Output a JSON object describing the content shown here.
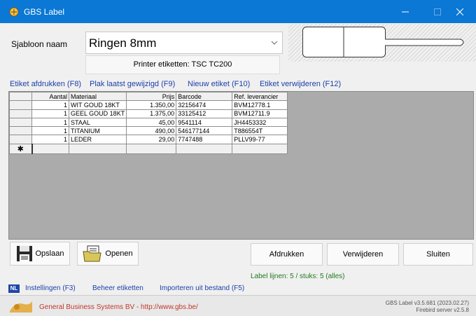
{
  "window": {
    "title": "GBS Label"
  },
  "form": {
    "template_label": "Sjabloon naam",
    "template_value": "Ringen 8mm",
    "printer_button": "Printer etiketten: TSC TC200"
  },
  "actions": {
    "print": "Etiket afdrukken (F8)",
    "paste": "Plak laatst gewijzigd (F9)",
    "new": "Nieuw etiket (F10)",
    "delete": "Etiket verwijderen (F12)"
  },
  "grid": {
    "columns": [
      "Aantal",
      "Materiaal",
      "Prijs",
      "Barcode",
      "Ref. leverancier"
    ],
    "rows": [
      {
        "aantal": "1",
        "materiaal": "WIT GOUD 18KT",
        "prijs": "1.350,00",
        "barcode": "32156474",
        "ref": "BVM12778.1"
      },
      {
        "aantal": "1",
        "materiaal": "GEEL GOUD 18KT",
        "prijs": "1.375,00",
        "barcode": "33125412",
        "ref": "BVM12711.9"
      },
      {
        "aantal": "1",
        "materiaal": "STAAL",
        "prijs": "45,00",
        "barcode": "9541114",
        "ref": "JH4453332"
      },
      {
        "aantal": "1",
        "materiaal": "TITANIUM",
        "prijs": "490,00",
        "barcode": "546177144",
        "ref": "T886554T"
      },
      {
        "aantal": "1",
        "materiaal": "LEDER",
        "prijs": "29,00",
        "barcode": "7747488",
        "ref": "PLLV99-77"
      }
    ],
    "new_row_marker": "✱"
  },
  "buttons": {
    "save": "Opslaan",
    "open": "Openen",
    "print": "Afdrukken",
    "remove": "Verwijderen",
    "close": "Sluiten"
  },
  "status": {
    "label_lines": "Label lijnen: 5 / stuks: 5 (alles)"
  },
  "bottom_menu": {
    "lang_badge": "NL",
    "settings": "Instellingen (F3)",
    "manage": "Beheer etiketten",
    "import": "Importeren uit bestand (F5)"
  },
  "footer": {
    "company": "General Business Systems BV  -  http://www.gbs.be/",
    "version": "GBS Label v3.5.681 (2023.02.27)",
    "server": "Firebird server v2.5.8"
  },
  "colors": {
    "titlebar": "#0a78d4",
    "link": "#1c3fa8",
    "status": "#1f7a1f",
    "company": "#c0392b"
  }
}
